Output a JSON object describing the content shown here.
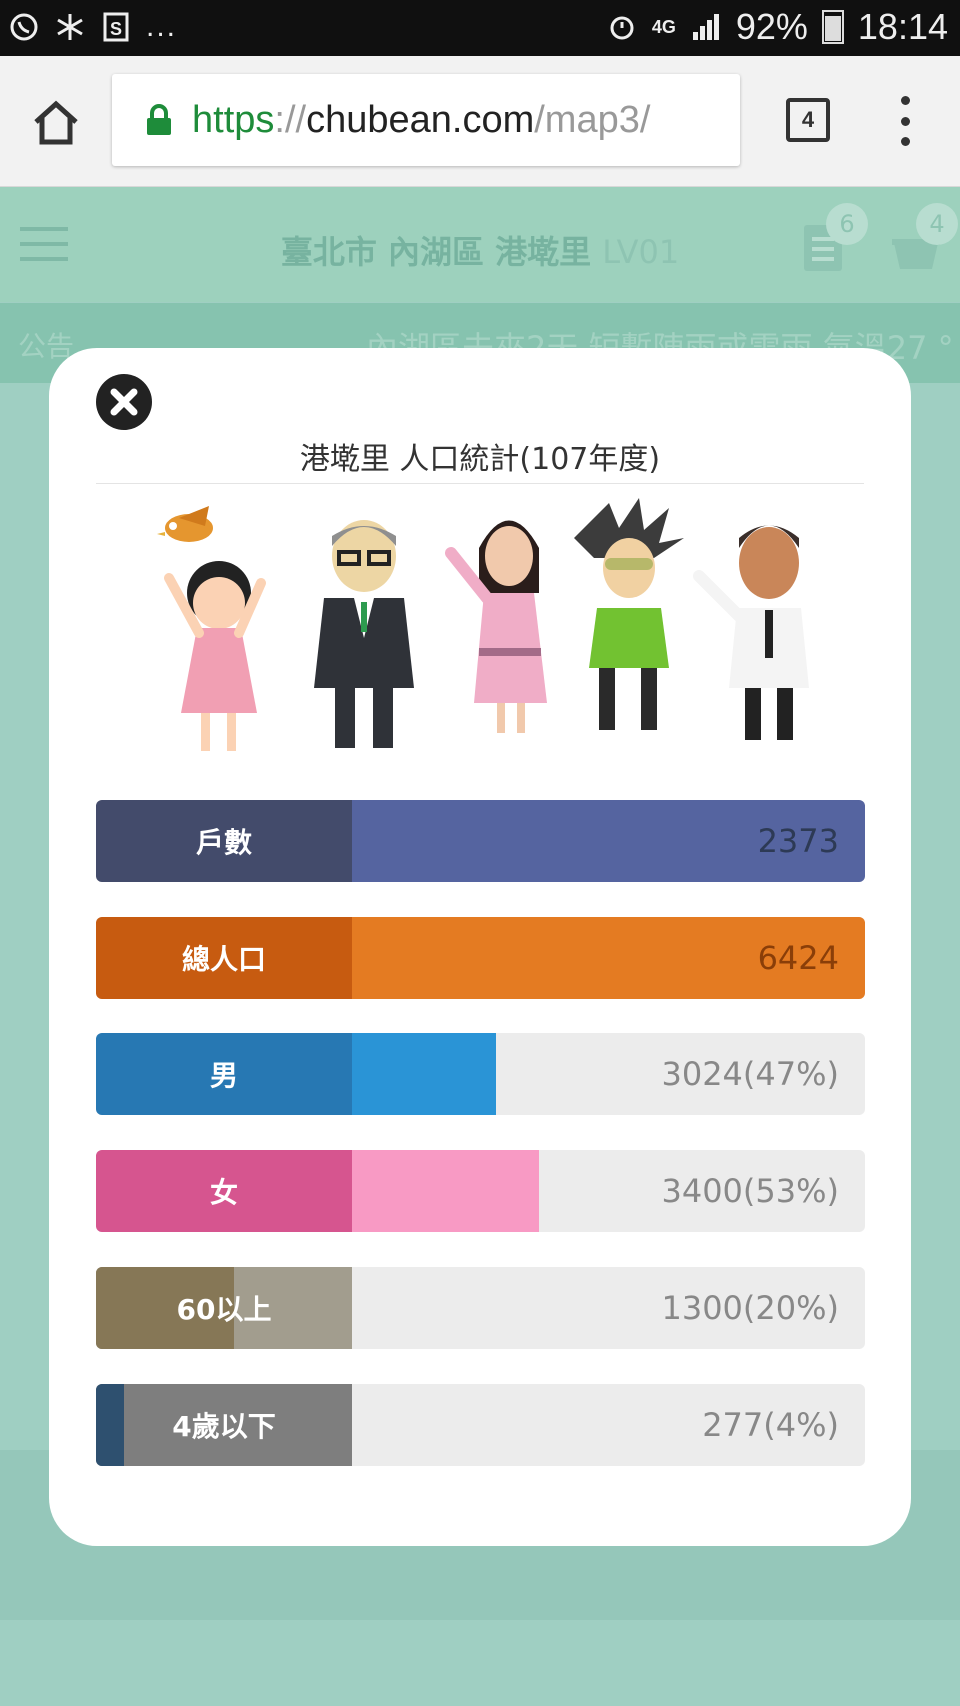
{
  "status_bar": {
    "battery": "92%",
    "time": "18:14",
    "network": "4G",
    "notif_more": "..."
  },
  "browser": {
    "url_scheme": "https",
    "url_sep": "://",
    "url_host": "chubean.com",
    "url_path": "/map3/",
    "tab_count": "4"
  },
  "page": {
    "title": "臺北市 內湖區 港墘里",
    "level": "LV01",
    "notes_badge": "6",
    "cart_badge": "4",
    "announce_label": "公告",
    "announce_text": "內湖區未來2天 短暫陣雨或雷雨 氣溫27 °"
  },
  "modal": {
    "title": "港墘里 人口統計(107年度)",
    "stats": [
      {
        "label": "戶數",
        "value": "2373",
        "fill": 1.0
      },
      {
        "label": "總人口",
        "value": "6424",
        "fill": 1.0
      },
      {
        "label": "男",
        "value": "3024(47%)",
        "fill": 0.47
      },
      {
        "label": "女",
        "value": "3400(53%)",
        "fill": 0.53
      },
      {
        "label": "60以上",
        "value": "1300(20%)",
        "fill": 0.2
      },
      {
        "label": "4歲以下",
        "value": "277(4%)",
        "fill": 0.04
      }
    ]
  },
  "colors": {
    "households": "#5564a0",
    "population": "#e47b22",
    "male": "#2a94d6",
    "female": "#f89ac4",
    "elderly": "#867756",
    "children": "#2e506f"
  }
}
